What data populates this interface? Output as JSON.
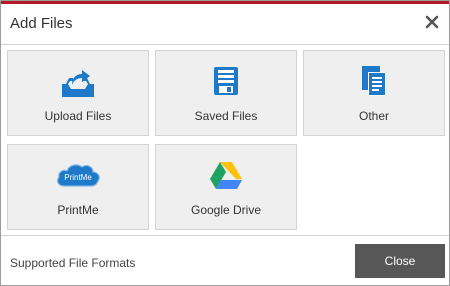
{
  "dialog": {
    "title": "Add Files",
    "close_icon": "close-icon",
    "accent_color": "#b01b26"
  },
  "sources": [
    {
      "label": "Upload Files",
      "icon": "upload-icon"
    },
    {
      "label": "Saved Files",
      "icon": "saved-files-icon"
    },
    {
      "label": "Other",
      "icon": "documents-icon"
    },
    {
      "label": "PrintMe",
      "icon": "printme-cloud-icon",
      "icon_text": "PrintMe"
    },
    {
      "label": "Google Drive",
      "icon": "google-drive-icon"
    }
  ],
  "colors": {
    "icon_blue": "#1e7ac8",
    "drive_green": "#1da462",
    "drive_yellow": "#ffc107",
    "drive_blue": "#4285f4"
  },
  "footer": {
    "supported_formats_link": "Supported File Formats",
    "close_label": "Close"
  }
}
